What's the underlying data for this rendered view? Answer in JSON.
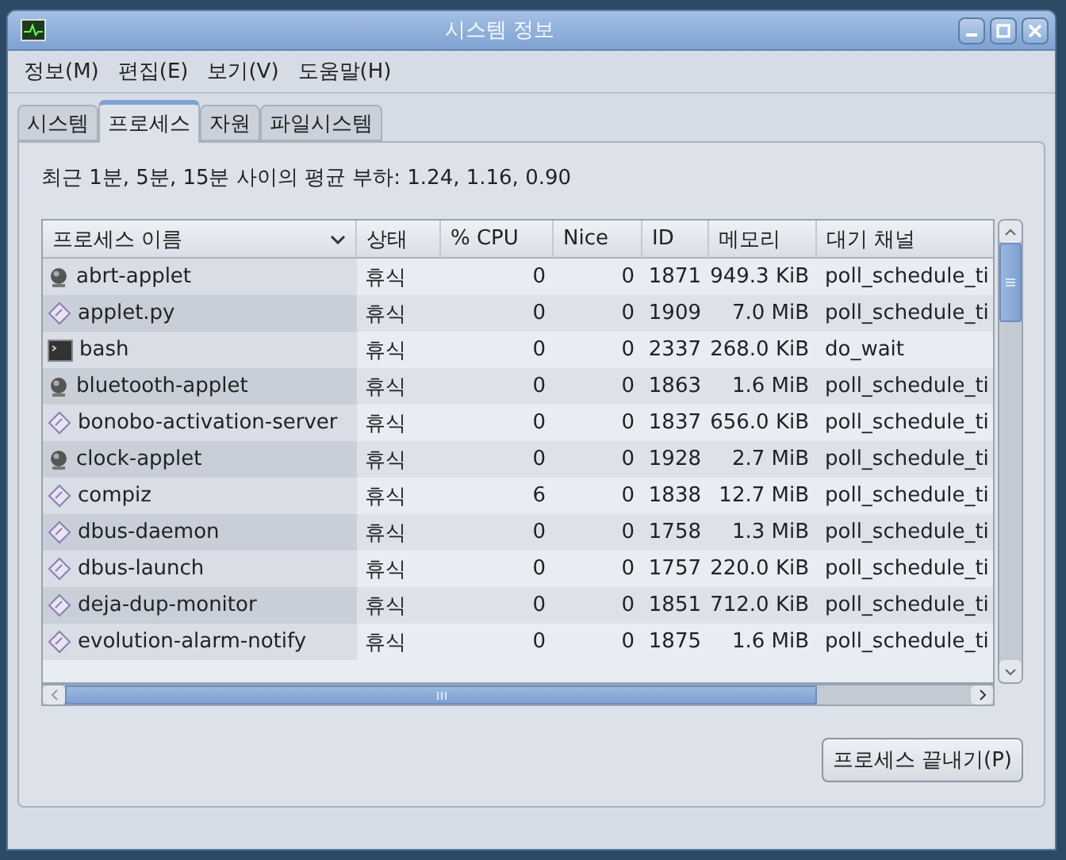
{
  "window": {
    "title": "시스템 정보"
  },
  "menu": [
    "정보(M)",
    "편집(E)",
    "보기(V)",
    "도움말(H)"
  ],
  "tabs": [
    {
      "label": "시스템",
      "selected": false
    },
    {
      "label": "프로세스",
      "selected": true
    },
    {
      "label": "자원",
      "selected": false
    },
    {
      "label": "파일시스템",
      "selected": false
    }
  ],
  "load_average": "최근 1분, 5분, 15분 사이의 평균 부하: 1.24, 1.16, 0.90",
  "table": {
    "columns": [
      "프로세스 이름",
      "상태",
      "% CPU",
      "Nice",
      "ID",
      "메모리",
      "대기 채널"
    ],
    "rows": [
      {
        "kind": "ball",
        "cells": [
          "abrt-applet",
          "휴식",
          "0",
          "0",
          "1871",
          "949.3 KiB",
          "poll_schedule_ti"
        ]
      },
      {
        "kind": "diamond",
        "cells": [
          "applet.py",
          "휴식",
          "0",
          "0",
          "1909",
          "7.0 MiB",
          "poll_schedule_ti"
        ]
      },
      {
        "kind": "terminal",
        "cells": [
          "bash",
          "휴식",
          "0",
          "0",
          "2337",
          "268.0 KiB",
          "do_wait"
        ]
      },
      {
        "kind": "ball",
        "cells": [
          "bluetooth-applet",
          "휴식",
          "0",
          "0",
          "1863",
          "1.6 MiB",
          "poll_schedule_ti"
        ]
      },
      {
        "kind": "diamond",
        "cells": [
          "bonobo-activation-server",
          "휴식",
          "0",
          "0",
          "1837",
          "656.0 KiB",
          "poll_schedule_ti"
        ]
      },
      {
        "kind": "ball",
        "cells": [
          "clock-applet",
          "휴식",
          "0",
          "0",
          "1928",
          "2.7 MiB",
          "poll_schedule_ti"
        ]
      },
      {
        "kind": "diamond",
        "cells": [
          "compiz",
          "휴식",
          "6",
          "0",
          "1838",
          "12.7 MiB",
          "poll_schedule_ti"
        ]
      },
      {
        "kind": "diamond",
        "cells": [
          "dbus-daemon",
          "휴식",
          "0",
          "0",
          "1758",
          "1.3 MiB",
          "poll_schedule_ti"
        ]
      },
      {
        "kind": "diamond",
        "cells": [
          "dbus-launch",
          "휴식",
          "0",
          "0",
          "1757",
          "220.0 KiB",
          "poll_schedule_ti"
        ]
      },
      {
        "kind": "diamond",
        "cells": [
          "deja-dup-monitor",
          "휴식",
          "0",
          "0",
          "1851",
          "712.0 KiB",
          "poll_schedule_ti"
        ]
      },
      {
        "kind": "diamond",
        "cells": [
          "evolution-alarm-notify",
          "휴식",
          "0",
          "0",
          "1875",
          "1.6 MiB",
          "poll_schedule_ti"
        ]
      }
    ]
  },
  "end_process_button": "프로세스 끝내기(P)"
}
